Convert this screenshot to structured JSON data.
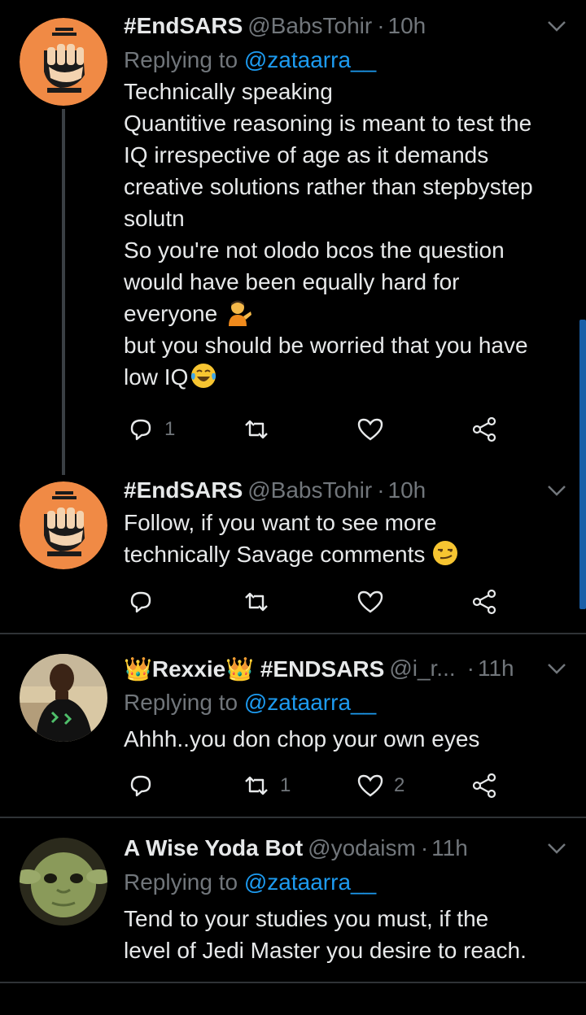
{
  "tweets": [
    {
      "name": "#EndSARS",
      "handle": "@BabsTohir",
      "time": "10h",
      "replying_prefix": "Replying to ",
      "replying_to": "@zataarra__",
      "lines": [
        "Technically speaking",
        "Quantitive reasoning is meant to test the",
        "IQ irrespective of age as it demands",
        "creative solutions rather than stepbystep",
        "solutn",
        "So you're not olodo bcos the question",
        "would have been equally hard for",
        "everyone",
        "but you should be worried that you have",
        "low IQ"
      ],
      "replies": "1",
      "retweets": "",
      "likes": ""
    },
    {
      "name": "#EndSARS",
      "handle": "@BabsTohir",
      "time": "10h",
      "lines": [
        "Follow, if you want to see more",
        "technically Savage comments"
      ],
      "replies": "",
      "retweets": "",
      "likes": ""
    },
    {
      "name_crown_left": "👑",
      "name_main": "Rexxie",
      "name_crown_right": "👑",
      "name_tag": "#ENDSARS",
      "handle": "@i_r...",
      "time": "11h",
      "replying_prefix": "Replying to ",
      "replying_to": "@zataarra__",
      "lines": [
        "Ahhh..you don chop your own eyes"
      ],
      "replies": "",
      "retweets": "1",
      "likes": "2"
    },
    {
      "name": "A Wise Yoda Bot",
      "handle": "@yodaism",
      "time": "11h",
      "replying_prefix": "Replying to ",
      "replying_to": "@zataarra__",
      "lines": [
        "Tend to your studies you must, if the",
        "level of Jedi Master you desire to reach."
      ]
    }
  ],
  "dot": "·",
  "colors": {
    "background": "#000000",
    "text": "#e7e9ea",
    "muted": "#71767b",
    "link": "#1d9bf0",
    "scrollbar": "#1a5fa8"
  },
  "icons": [
    "chevron-down-icon",
    "reply-icon",
    "retweet-icon",
    "like-icon",
    "share-icon"
  ]
}
